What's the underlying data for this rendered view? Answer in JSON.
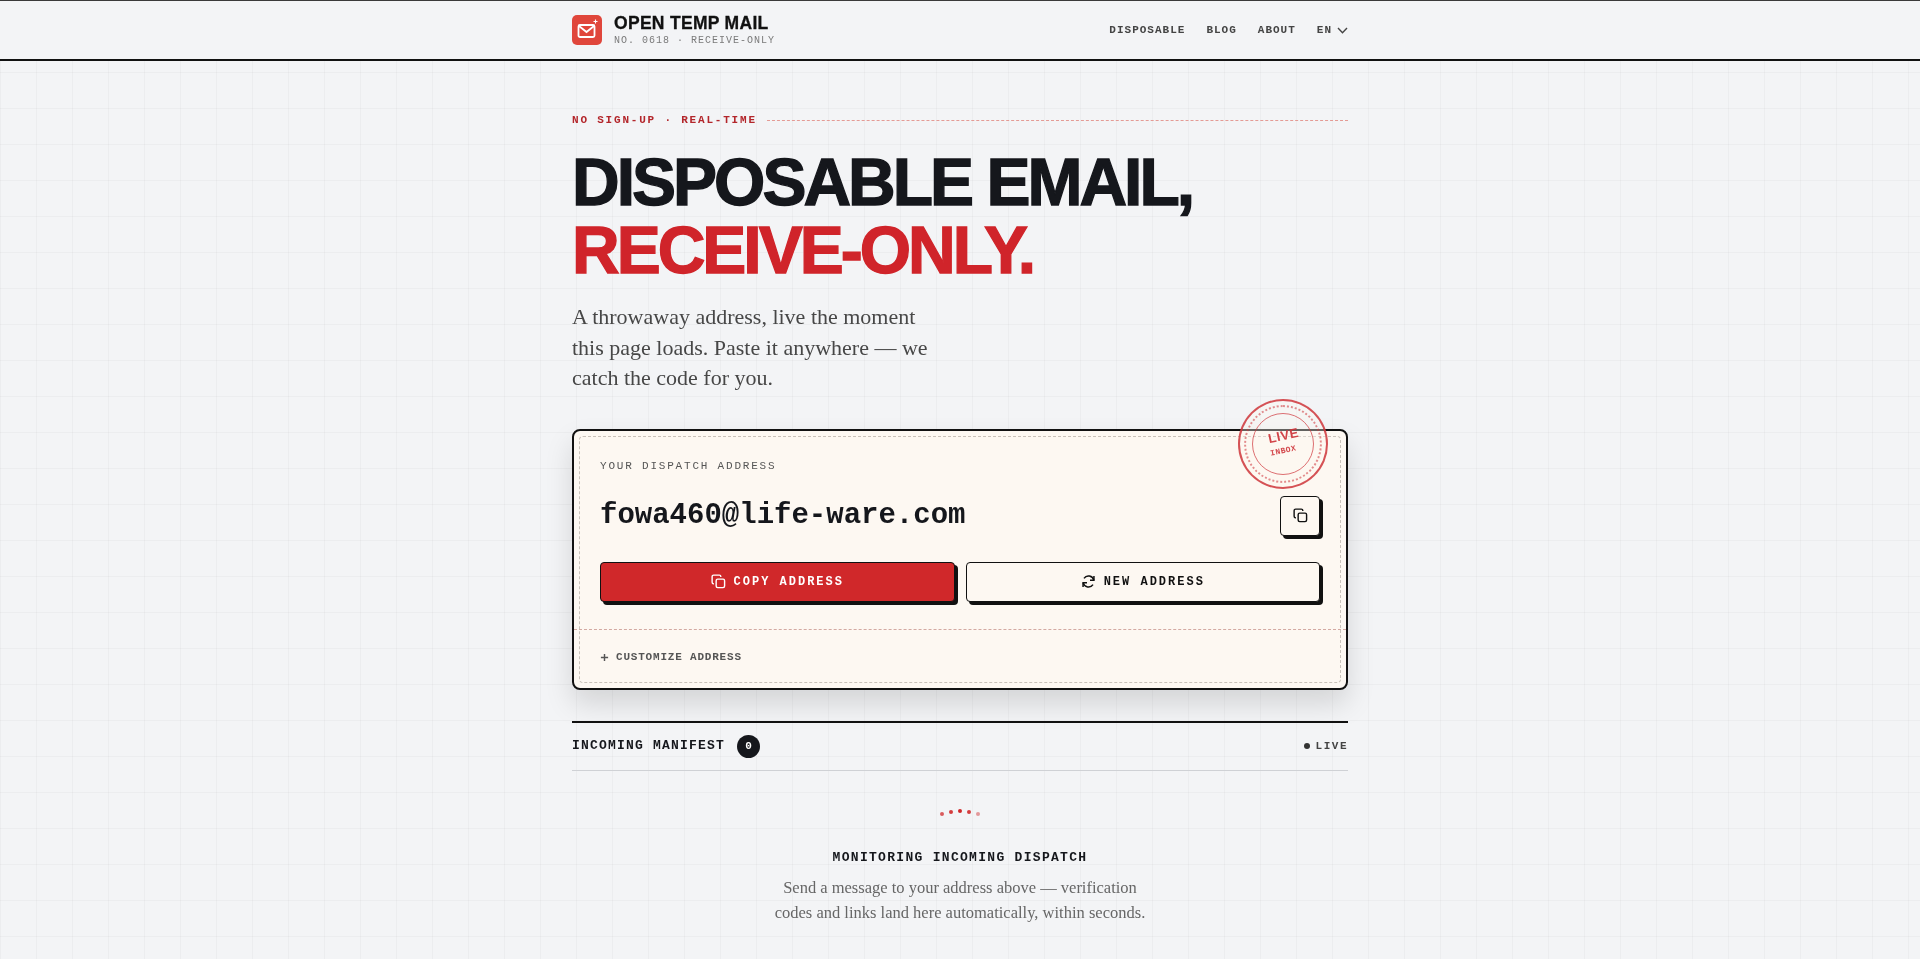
{
  "header": {
    "brand": {
      "title": "OPEN TEMP MAIL",
      "subtitle": "NO. 0618 · RECEIVE-ONLY"
    },
    "nav": [
      {
        "label": "DISPOSABLE"
      },
      {
        "label": "BLOG"
      },
      {
        "label": "ABOUT"
      }
    ],
    "language": {
      "label": "EN"
    }
  },
  "hero": {
    "eyebrow": "NO SIGN-UP · REAL-TIME",
    "headline": [
      {
        "text": "DISPOSABLE EMAIL,",
        "accent": false
      },
      {
        "text": "RECEIVE-ONLY.",
        "accent": true
      }
    ],
    "intro": "A throwaway address, live the moment this page loads. Paste it anywhere — we catch the code for you."
  },
  "address_card": {
    "label": "YOUR DISPATCH ADDRESS",
    "address": "fowa460@life-ware.com",
    "stamp": {
      "title": "LIVE",
      "subtitle": "INBOX"
    },
    "actions": [
      {
        "kind": "copy",
        "label": "COPY ADDRESS"
      },
      {
        "kind": "renew",
        "label": "NEW ADDRESS"
      }
    ],
    "customize": {
      "label": "CUSTOMIZE ADDRESS",
      "expanded": false
    }
  },
  "inbox": {
    "title": "INCOMING MANIFEST",
    "count": "0",
    "status": "LIVE",
    "empty_state": {
      "title": "MONITORING INCOMING DISPATCH",
      "text": "Send a message to your address above — verification codes and links land here automatically, within seconds."
    }
  }
}
